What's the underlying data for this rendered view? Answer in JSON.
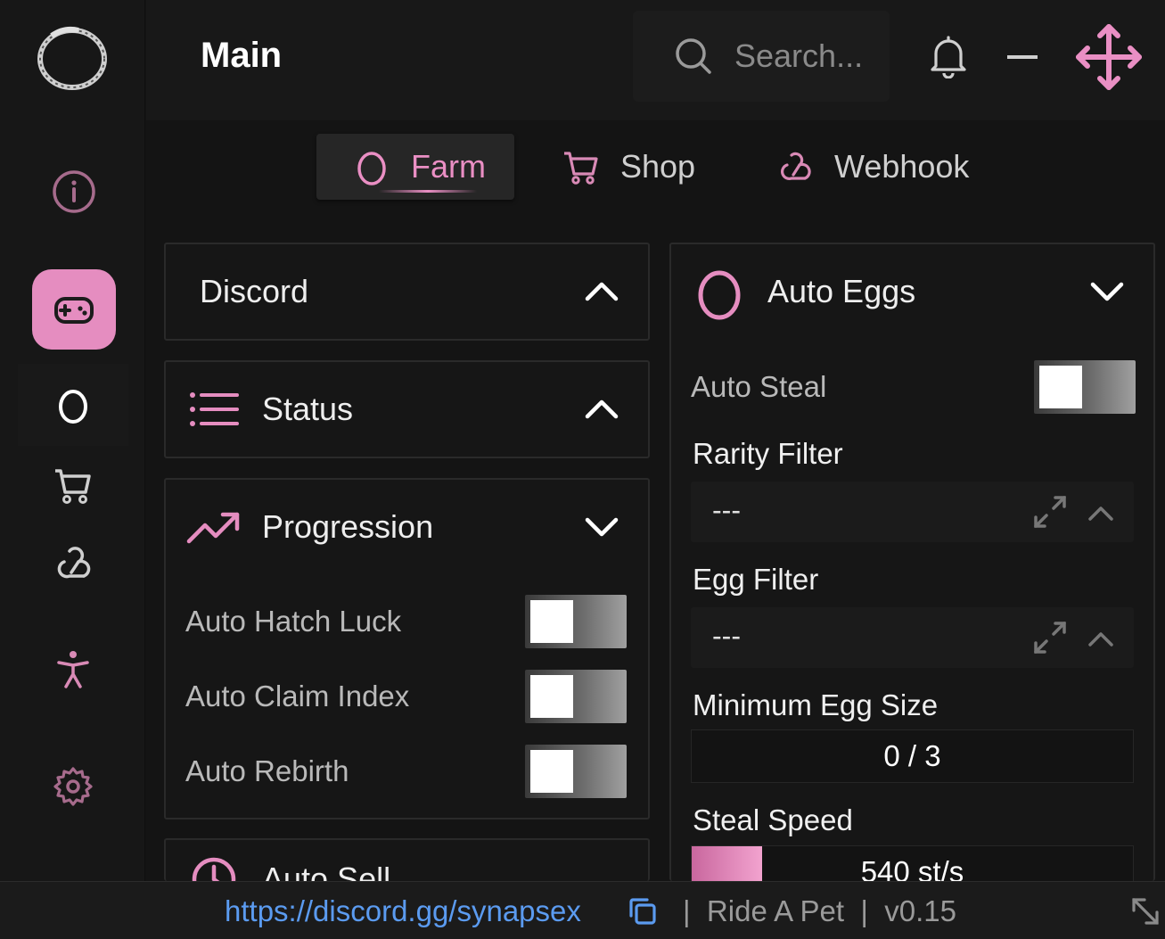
{
  "app": {
    "title": "Main"
  },
  "search": {
    "placeholder": "Search..."
  },
  "colors": {
    "accent": "#ea8fc4",
    "link": "#5b9bf0",
    "background": "#141414"
  },
  "sidebar": {
    "icons": [
      "info-icon",
      "gamepad-icon",
      "egg-icon",
      "cart-icon",
      "webhook-icon",
      "person-icon",
      "gear-icon"
    ],
    "active": "gamepad-icon"
  },
  "tabs": [
    {
      "label": "Farm",
      "icon": "egg-icon",
      "active": true
    },
    {
      "label": "Shop",
      "icon": "cart-icon",
      "active": false
    },
    {
      "label": "Webhook",
      "icon": "webhook-icon",
      "active": false
    }
  ],
  "left": {
    "discord": {
      "title": "Discord",
      "expanded": false
    },
    "status": {
      "title": "Status",
      "icon": "list-icon",
      "expanded": false
    },
    "progression": {
      "title": "Progression",
      "icon": "trending-up-icon",
      "expanded": true,
      "toggles": [
        {
          "label": "Auto Hatch Luck",
          "on": false
        },
        {
          "label": "Auto Claim Index",
          "on": false
        },
        {
          "label": "Auto Rebirth",
          "on": false
        }
      ]
    },
    "next": {
      "title": "Auto Sell",
      "icon": "clock-icon"
    }
  },
  "right": {
    "auto_eggs": {
      "title": "Auto Eggs",
      "icon": "egg-icon",
      "expanded": true,
      "auto_steal": {
        "label": "Auto Steal",
        "on": false
      },
      "rarity_filter": {
        "label": "Rarity Filter",
        "value": "---"
      },
      "egg_filter": {
        "label": "Egg Filter",
        "value": "---"
      },
      "min_egg_size": {
        "label": "Minimum Egg Size",
        "value": "0 / 3"
      },
      "steal_speed": {
        "label": "Steal Speed",
        "value": "540 st/s",
        "fill": 0.16
      }
    }
  },
  "footer": {
    "link": "https://discord.gg/synapsex",
    "game": "Ride A Pet",
    "version": "v0.15"
  }
}
